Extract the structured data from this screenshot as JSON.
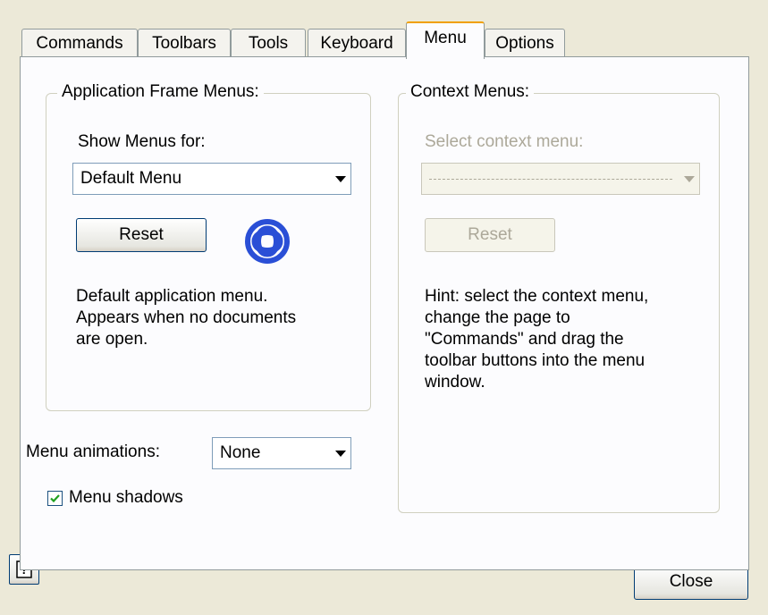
{
  "tabs": [
    {
      "label": "Commands"
    },
    {
      "label": "Toolbars"
    },
    {
      "label": "Tools"
    },
    {
      "label": "Keyboard"
    },
    {
      "label": "Menu"
    },
    {
      "label": "Options"
    }
  ],
  "active_tab": "Menu",
  "app_frame": {
    "legend": "Application Frame Menus:",
    "show_for_label": "Show Menus for:",
    "selected": "Default Menu",
    "reset_label": "Reset",
    "logo_icon": "app-logo-icon",
    "description_lines": [
      "Default application menu.",
      "Appears when no documents",
      "are open."
    ]
  },
  "context": {
    "legend": "Context Menus:",
    "select_label": "Select context menu:",
    "reset_label": "Reset",
    "hint_lines": [
      "Hint: select the context menu,",
      "change the page to",
      "\"Commands\" and drag the",
      "toolbar buttons into the menu",
      "window."
    ]
  },
  "animations": {
    "label": "Menu animations:",
    "value": "None"
  },
  "shadows": {
    "label": "Menu shadows",
    "checked": true
  },
  "footer": {
    "help_icon": "help-icon",
    "close_label": "Close"
  },
  "colors": {
    "logo": "#2a4fd6",
    "active_tab_accent": "#f0a000"
  }
}
